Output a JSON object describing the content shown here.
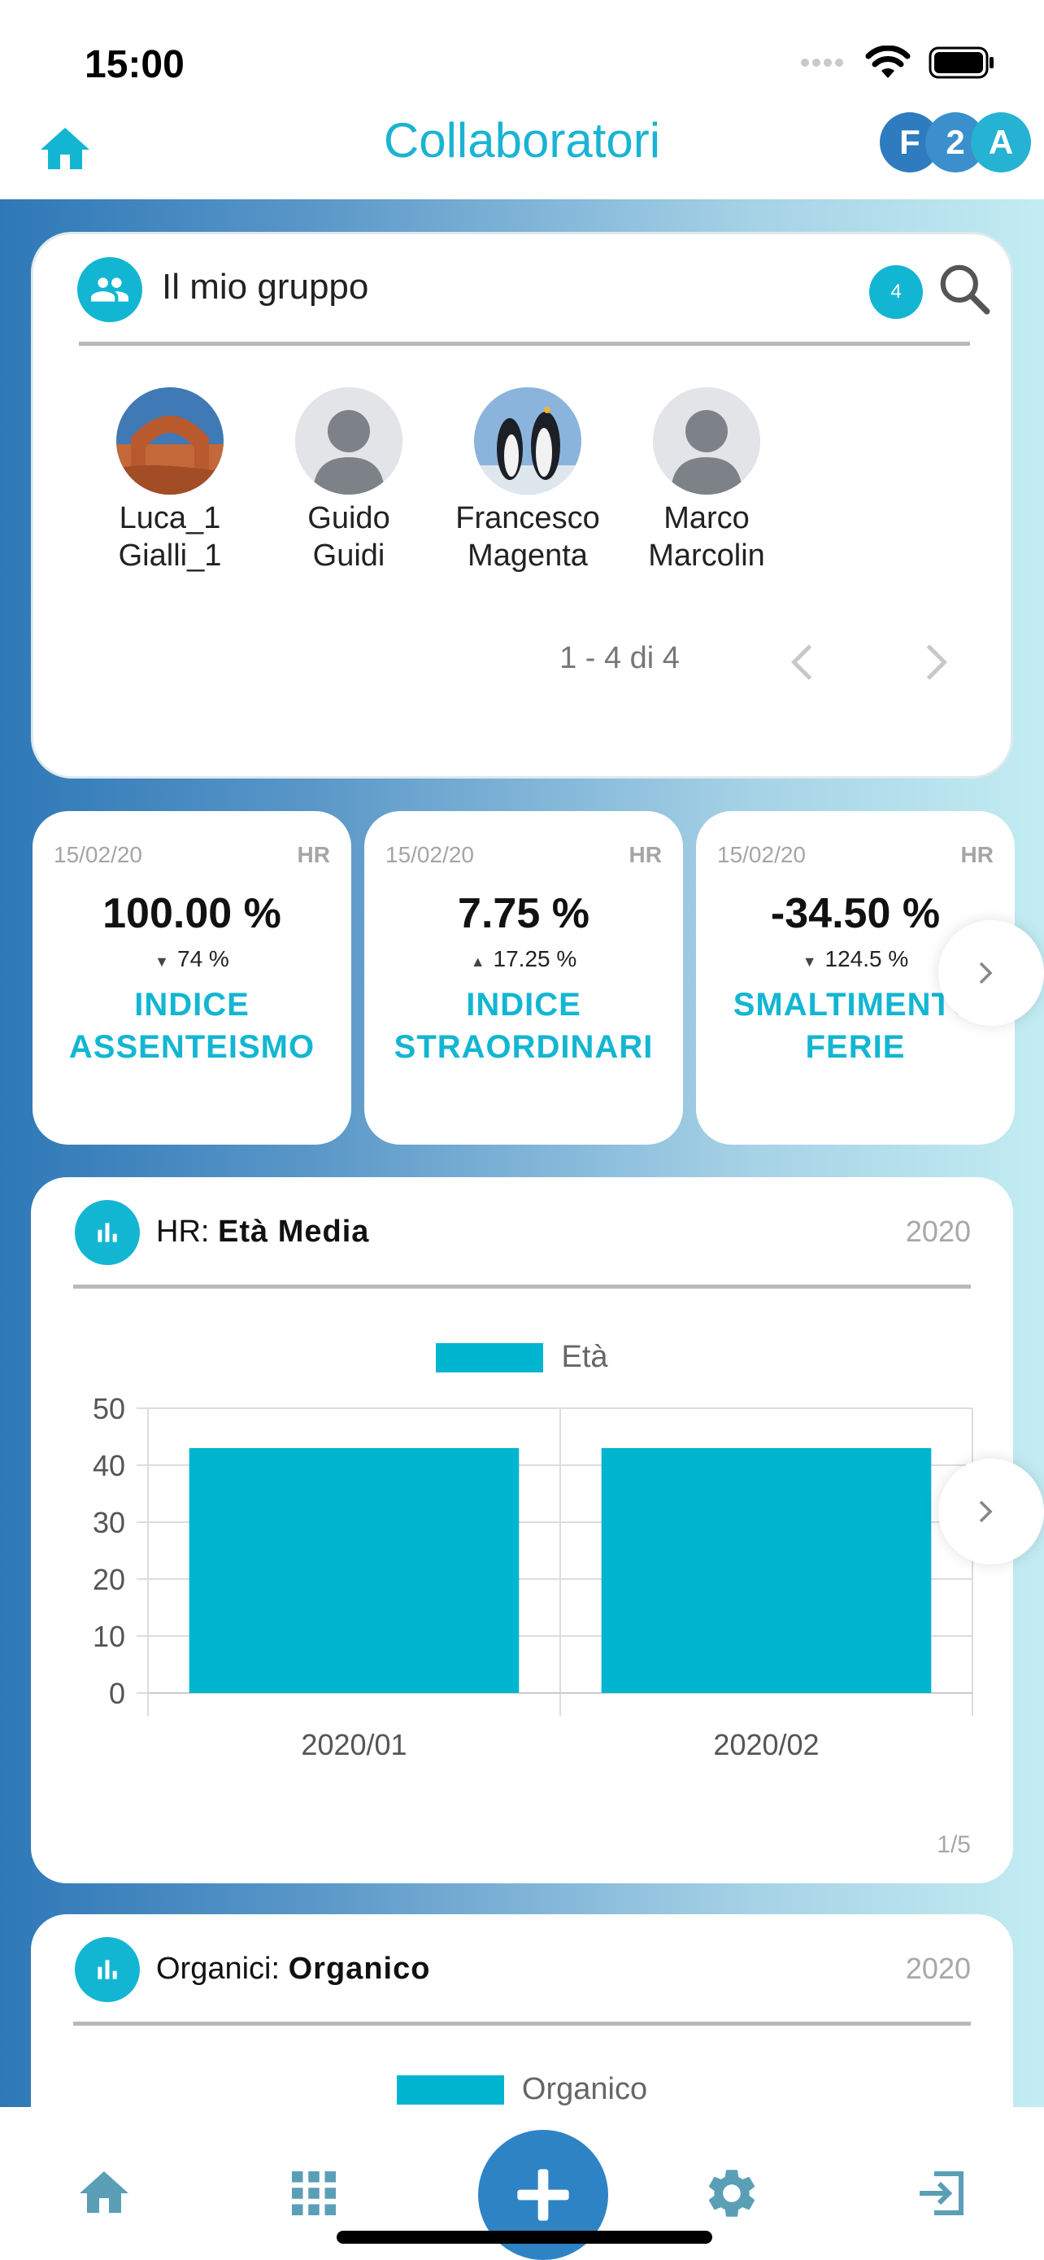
{
  "status_bar": {
    "time": "15:00"
  },
  "header": {
    "title": "Collaboratori",
    "logo_letters": [
      "F",
      "2",
      "A"
    ]
  },
  "group": {
    "title": "Il mio gruppo",
    "count": "4",
    "members": [
      {
        "first": "Luca_1",
        "last": "Gialli_1",
        "avatar": "landscape-photo"
      },
      {
        "first": "Guido",
        "last": "Guidi",
        "avatar": "person-placeholder"
      },
      {
        "first": "Francesco",
        "last": "Magenta",
        "avatar": "penguins-photo"
      },
      {
        "first": "Marco",
        "last": "Marcolin",
        "avatar": "person-placeholder"
      }
    ],
    "pagination": "1 - 4 di 4"
  },
  "kpis": [
    {
      "date": "15/02/20",
      "tag": "HR",
      "value": "100.00 %",
      "trend": "down",
      "delta": "74 %",
      "label_line1": "INDICE",
      "label_line2": "ASSENTEISMO"
    },
    {
      "date": "15/02/20",
      "tag": "HR",
      "value": "7.75 %",
      "trend": "up",
      "delta": "17.25 %",
      "label_line1": "INDICE",
      "label_line2": "STRAORDINARI"
    },
    {
      "date": "15/02/20",
      "tag": "HR",
      "value": "-34.50 %",
      "trend": "down",
      "delta": "124.5 %",
      "label_line1": "SMALTIMENTO",
      "label_line2": "FERIE"
    }
  ],
  "chart_cards": [
    {
      "category": "HR: ",
      "name": "Età Media",
      "year": "2020",
      "page": "1/5"
    },
    {
      "category": "Organici: ",
      "name": "Organico",
      "year": "2020"
    }
  ],
  "chart_data": [
    {
      "type": "bar",
      "categories": [
        "2020/01",
        "2020/02"
      ],
      "series": [
        {
          "name": "Età",
          "values": [
            43,
            43
          ]
        }
      ],
      "ylim": [
        0,
        50
      ],
      "yticks": [
        0,
        10,
        20,
        30,
        40,
        50
      ],
      "grid": true,
      "legend": "top",
      "color": "#00b5d0"
    },
    {
      "type": "bar",
      "series": [
        {
          "name": "Organico"
        }
      ],
      "legend": "top",
      "color": "#00b5d0"
    }
  ],
  "bottom_nav": {
    "items": [
      "home-icon",
      "apps-grid-icon",
      "add-icon",
      "settings-icon",
      "logout-icon"
    ]
  },
  "colors": {
    "accent": "#13b6d2",
    "bar": "#00b5d0",
    "fab": "#2e83c5",
    "nav_icon": "#5a9fb5"
  }
}
